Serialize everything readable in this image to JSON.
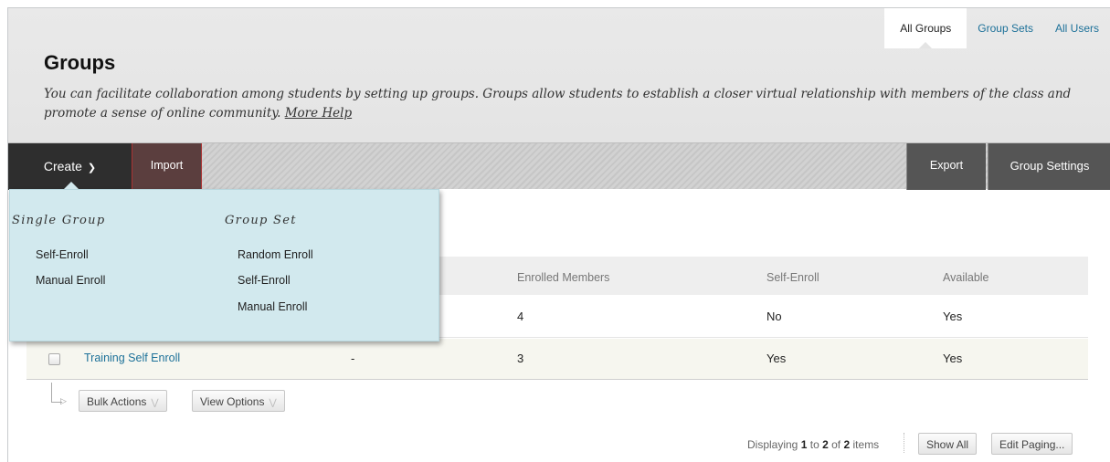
{
  "tabs": [
    {
      "label": "All Groups",
      "active": true
    },
    {
      "label": "Group Sets",
      "active": false
    },
    {
      "label": "All Users",
      "active": false
    }
  ],
  "header": {
    "title": "Groups",
    "description": "You can facilitate collaboration among students by setting up groups. Groups allow students to establish a closer virtual relationship with members of the class and promote a sense of online community.",
    "help_link": "More Help"
  },
  "toolbar": {
    "create_label": "Create",
    "import_label": "Import",
    "export_label": "Export",
    "settings_label": "Group Settings"
  },
  "create_menu": {
    "single_group": {
      "heading": "Single Group",
      "items": [
        "Self-Enroll",
        "Manual Enroll"
      ]
    },
    "group_set": {
      "heading": "Group Set",
      "items": [
        "Random Enroll",
        "Self-Enroll",
        "Manual Enroll"
      ]
    }
  },
  "table": {
    "columns": [
      "Enrolled Members",
      "Self-Enroll",
      "Available"
    ],
    "rows": [
      {
        "name": "",
        "group_set": "",
        "enrolled": "4",
        "self_enroll": "No",
        "available": "Yes"
      },
      {
        "name": "Training Self Enroll",
        "group_set": "-",
        "enrolled": "3",
        "self_enroll": "Yes",
        "available": "Yes"
      }
    ]
  },
  "actions": {
    "bulk_label": "Bulk Actions",
    "view_label": "View Options"
  },
  "paging": {
    "prefix": "Displaying",
    "from": "1",
    "to_word": "to",
    "to": "2",
    "of_word": "of",
    "total": "2",
    "suffix": "items",
    "show_all": "Show All",
    "edit_paging": "Edit Paging..."
  },
  "colors": {
    "link": "#1d7199",
    "menu_bg": "#d2e9ee",
    "toolbar_dark": "#2e2e2e"
  }
}
